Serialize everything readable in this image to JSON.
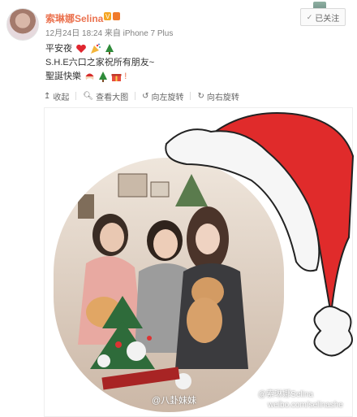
{
  "post": {
    "username": "索琳娜Selina",
    "time": "12月24日 18:24",
    "source": "来自 iPhone 7 Plus",
    "follow_label": "已关注",
    "lines": [
      "平安夜",
      "S.H.E六口之家祝所有朋友~",
      "聖誕快樂"
    ],
    "toolbar": {
      "collapse": "收起",
      "view_large": "查看大图",
      "rotate_left": "向左旋转",
      "rotate_right": "向右旋转"
    }
  },
  "image": {
    "watermark_label": "@八卦妹妹",
    "weibo_mark": "@索琳娜Selina",
    "weibo_url": "weibo.com/selinashe"
  },
  "colors": {
    "username": "#eb7350",
    "hat_red": "#e02b2b",
    "text": "#333333"
  },
  "icons": [
    "vip-badge-icon",
    "heart-icon",
    "party-popper-icon",
    "christmas-tree-icon",
    "santa-icon",
    "gift-icon",
    "collapse-icon",
    "zoom-icon",
    "rotate-left-icon",
    "rotate-right-icon"
  ]
}
